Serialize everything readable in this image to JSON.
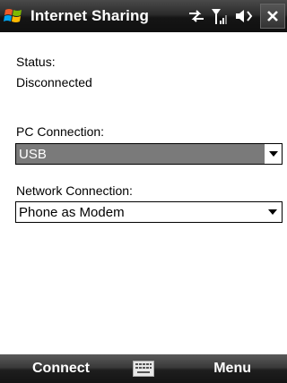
{
  "titlebar": {
    "title": "Internet Sharing",
    "start_icon": "windows-flag-icon",
    "status_icons": [
      "connectivity-arrows-icon",
      "signal-strength-icon",
      "speaker-icon"
    ],
    "close_label": "×"
  },
  "content": {
    "status_label": "Status:",
    "status_value": "Disconnected",
    "pc_connection_label": "PC Connection:",
    "pc_connection_value": "USB",
    "network_connection_label": "Network Connection:",
    "network_connection_value": "Phone as Modem"
  },
  "softkeys": {
    "left": "Connect",
    "right": "Menu",
    "center_icon": "keyboard-icon"
  },
  "colors": {
    "selected_dropdown_bg": "#7a7a7a",
    "bar_dark": "#151515"
  }
}
